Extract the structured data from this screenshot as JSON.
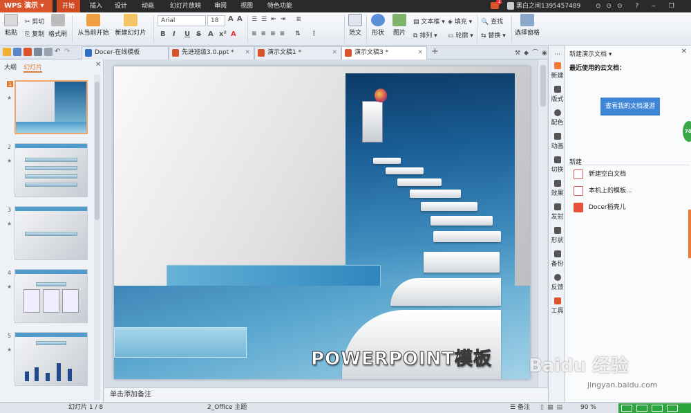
{
  "app": {
    "logo_label": "WPS 演示",
    "user_name": "黑白之间1395457489",
    "notification_count": "1"
  },
  "menu": [
    "开始",
    "插入",
    "设计",
    "动画",
    "幻灯片放映",
    "审阅",
    "视图",
    "特色功能"
  ],
  "ribbon": {
    "paste": "粘贴",
    "cut": "剪切",
    "copy": "复制",
    "format_painter": "格式刷",
    "from_current": "从当前开始",
    "new_slide": "新建幻灯片",
    "font_name": "Arial",
    "font_size": "18",
    "fan_wen": "范文",
    "shape": "形状",
    "picture": "图片",
    "textbox": "文本框",
    "fill": "填充",
    "arrange": "排列",
    "outline": "轮廓",
    "find": "查找",
    "replace": "替换",
    "select_pane": "选择窗格"
  },
  "tabs": [
    {
      "label": "Docer-在线模板",
      "color": "#2d6fc4"
    },
    {
      "label": "先进班级3.0.ppt *",
      "color": "#d9532b"
    },
    {
      "label": "演示文稿1 *",
      "color": "#d9532b"
    },
    {
      "label": "演示文稿3 *",
      "color": "#d9532b",
      "active": true
    }
  ],
  "left_panel": {
    "tab_outline": "大纲",
    "tab_slides": "幻灯片",
    "slide_numbers": [
      "1",
      "2",
      "3",
      "4",
      "5"
    ]
  },
  "slide": {
    "title": "POWERPOINT模板"
  },
  "notes_placeholder": "单击添加备注",
  "right_sidebar": [
    "新建",
    "版式",
    "配色",
    "动画",
    "切换",
    "效果",
    "发射",
    "形状",
    "备份",
    "反馈",
    "工具"
  ],
  "task_pane": {
    "title": "新建演示文档 ▾",
    "recent_cloud": "最近使用的云文档：",
    "cloud_button": "查看我的文档漫游",
    "new_heading": "新建",
    "items": [
      "新建空白文档",
      "本机上的模板...",
      "Docer稻壳儿"
    ],
    "badge": "70"
  },
  "status": {
    "slide_counter": "幻灯片 1 / 8",
    "theme": "2_Office 主题",
    "notes": "备注",
    "zoom": "90 %"
  },
  "watermark": {
    "main": "Baidu 经验",
    "sub": "jingyan.baidu.com"
  }
}
